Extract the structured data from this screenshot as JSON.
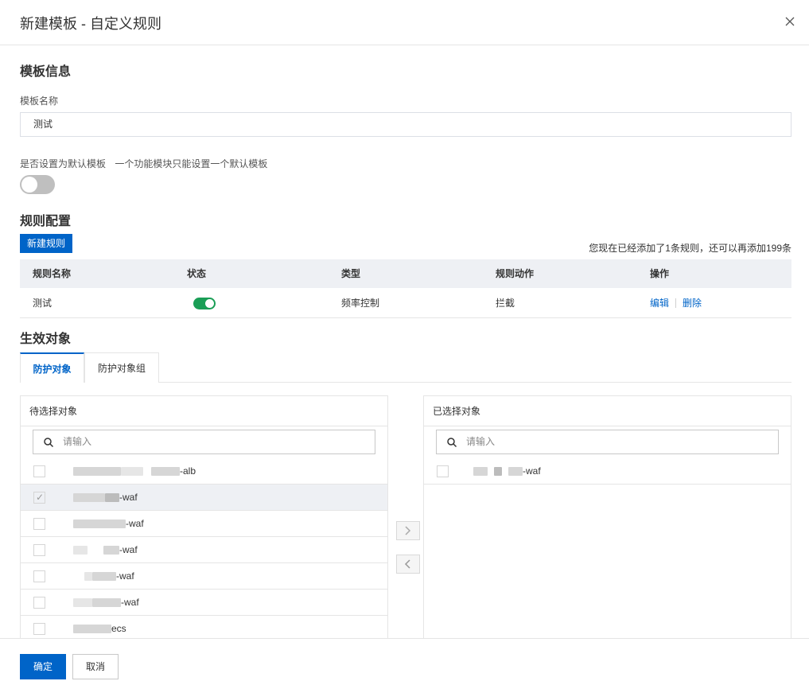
{
  "dialog": {
    "title": "新建模板 - 自定义规则"
  },
  "template_info": {
    "section_title": "模板信息",
    "name_label": "模板名称",
    "name_value": "测试",
    "default_label": "是否设置为默认模板",
    "default_hint": "一个功能模块只能设置一个默认模板"
  },
  "rules": {
    "section_title": "规则配置",
    "new_button": "新建规则",
    "count_text": "您现在已经添加了1条规则，还可以再添加199条",
    "columns": [
      "规则名称",
      "状态",
      "类型",
      "规则动作",
      "操作"
    ],
    "rows": [
      {
        "name": "测试",
        "type": "频率控制",
        "action": "拦截",
        "edit": "编辑",
        "delete": "删除"
      }
    ]
  },
  "targets": {
    "section_title": "生效对象",
    "tabs": [
      "防护对象",
      "防护对象组"
    ],
    "available": {
      "title": "待选择对象",
      "search_placeholder": "请输入",
      "items": [
        {
          "suffix": "-alb",
          "checked": false
        },
        {
          "suffix": "-waf",
          "checked": true
        },
        {
          "suffix": "-waf",
          "checked": false
        },
        {
          "suffix": "-waf",
          "checked": false
        },
        {
          "suffix": "-waf",
          "checked": false
        },
        {
          "suffix": "-waf",
          "checked": false
        },
        {
          "suffix": "ecs",
          "checked": false
        }
      ]
    },
    "selected": {
      "title": "已选择对象",
      "search_placeholder": "请输入",
      "items": [
        {
          "suffix": "-waf"
        }
      ]
    }
  },
  "footer": {
    "confirm": "确定",
    "cancel": "取消"
  },
  "colors": {
    "primary": "#0064c8",
    "switch_on": "#1a9e56",
    "switch_off": "#bfbfbf"
  }
}
